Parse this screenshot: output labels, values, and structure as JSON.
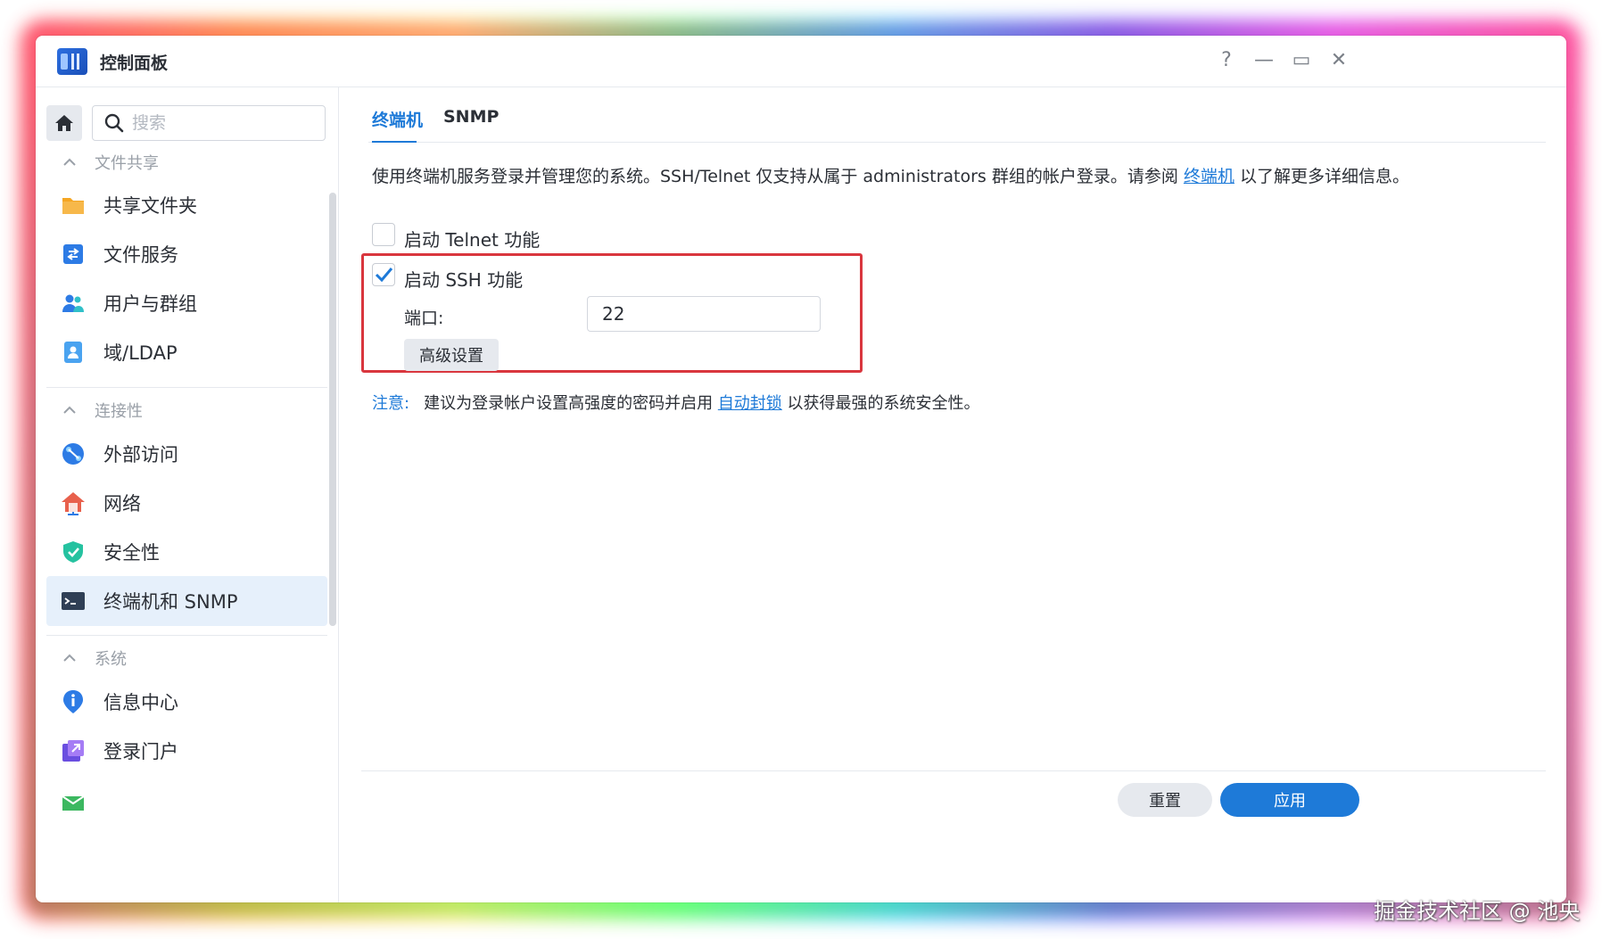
{
  "window": {
    "title": "控制面板"
  },
  "titlebar": {
    "help_glyph": "?",
    "minimize_glyph": "—",
    "maximize_glyph": "▭",
    "close_glyph": "✕"
  },
  "sidebar": {
    "search_placeholder": "搜索",
    "sections": [
      {
        "header": "文件共享",
        "items": [
          {
            "label": "共享文件夹",
            "icon": "folder-icon"
          },
          {
            "label": "文件服务",
            "icon": "file-services-icon"
          },
          {
            "label": "用户与群组",
            "icon": "users-icon"
          },
          {
            "label": "域/LDAP",
            "icon": "ldap-icon"
          }
        ]
      },
      {
        "header": "连接性",
        "items": [
          {
            "label": "外部访问",
            "icon": "external-access-icon"
          },
          {
            "label": "网络",
            "icon": "network-icon"
          },
          {
            "label": "安全性",
            "icon": "shield-icon"
          },
          {
            "label": "终端机和 SNMP",
            "icon": "terminal-icon",
            "active": true
          }
        ]
      },
      {
        "header": "系统",
        "items": [
          {
            "label": "信息中心",
            "icon": "info-icon"
          },
          {
            "label": "登录门户",
            "icon": "login-portal-icon"
          }
        ]
      }
    ]
  },
  "main": {
    "tabs": [
      {
        "label": "终端机",
        "active": true
      },
      {
        "label": "SNMP"
      }
    ],
    "description_prefix": "使用终端机服务登录并管理您的系统。SSH/Telnet 仅支持从属于 administrators 群组的帐户登录。请参阅 ",
    "description_link": "终端机",
    "description_suffix": " 以了解更多详细信息。",
    "telnet": {
      "label": "启动 Telnet 功能",
      "checked": false
    },
    "ssh": {
      "label": "启动 SSH 功能",
      "checked": true
    },
    "port": {
      "label": "端口:",
      "value": "22"
    },
    "advanced_button": "高级设置",
    "note_label": "注意:",
    "note_prefix": "建议为登录帐户设置高强度的密码并启用 ",
    "note_link": "自动封锁",
    "note_suffix": " 以获得最强的系统安全性。"
  },
  "footer": {
    "reset_label": "重置",
    "apply_label": "应用"
  },
  "watermark": "掘金技术社区 @ 池央",
  "colors": {
    "accent": "#1e7ad8",
    "highlight_box": "#d9363e",
    "active_item_bg": "#e6f0fb"
  }
}
